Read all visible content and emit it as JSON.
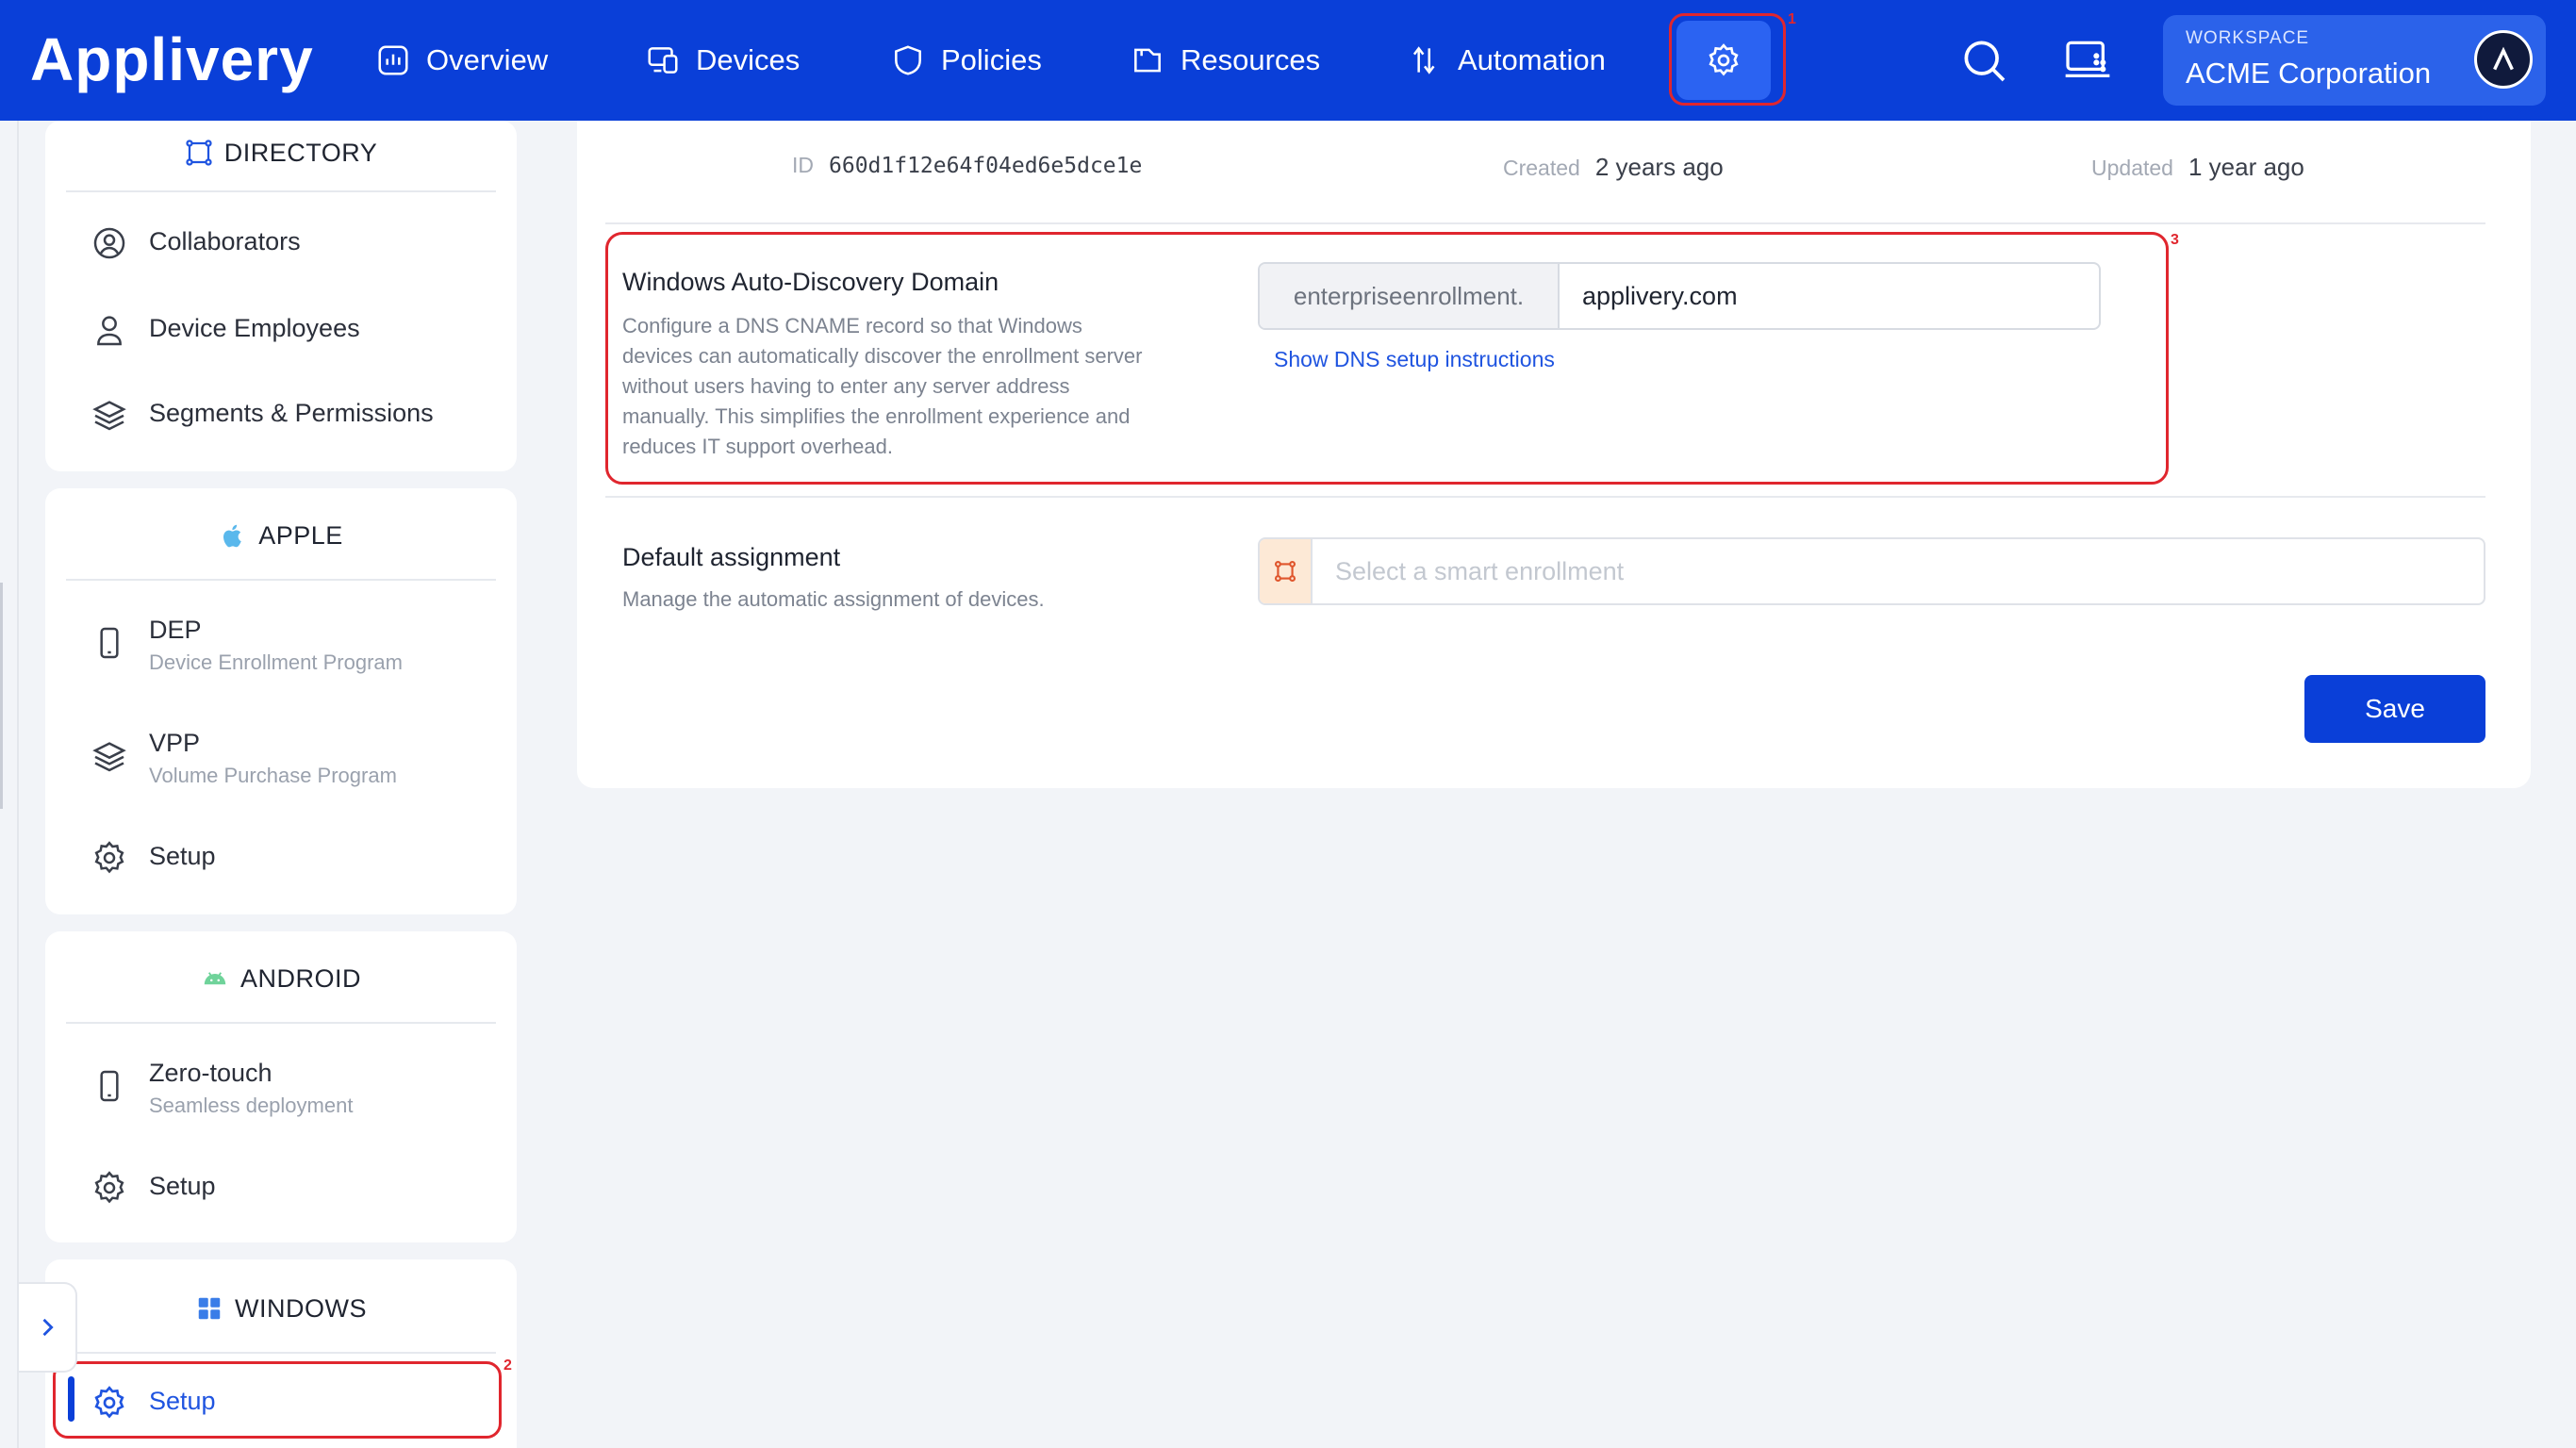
{
  "app": {
    "logo": "Applivery"
  },
  "nav": {
    "items": [
      {
        "label": "Overview",
        "icon": "chart-box-icon"
      },
      {
        "label": "Devices",
        "icon": "devices-icon"
      },
      {
        "label": "Policies",
        "icon": "shield-icon"
      },
      {
        "label": "Resources",
        "icon": "folder-icon"
      },
      {
        "label": "Automation",
        "icon": "arrows-icon"
      }
    ],
    "settings_badge": "1"
  },
  "workspace": {
    "label": "WORKSPACE",
    "name": "ACME Corporation"
  },
  "sidebar": {
    "directory": {
      "title": "DIRECTORY",
      "items": [
        {
          "label": "Collaborators"
        },
        {
          "label": "Device Employees"
        },
        {
          "label": "Segments & Permissions"
        }
      ]
    },
    "apple": {
      "title": "APPLE",
      "items": [
        {
          "label": "DEP",
          "sub": "Device Enrollment Program"
        },
        {
          "label": "VPP",
          "sub": "Volume Purchase Program"
        },
        {
          "label": "Setup"
        }
      ]
    },
    "android": {
      "title": "ANDROID",
      "items": [
        {
          "label": "Zero-touch",
          "sub": "Seamless deployment"
        },
        {
          "label": "Setup"
        }
      ]
    },
    "windows": {
      "title": "WINDOWS",
      "items": [
        {
          "label": "Setup"
        }
      ],
      "badge": "2"
    }
  },
  "meta": {
    "id_label": "ID",
    "id_value": "660d1f12e64f04ed6e5dce1e",
    "created_label": "Created",
    "created_value": "2 years ago",
    "updated_label": "Updated",
    "updated_value": "1 year ago"
  },
  "autodiscovery": {
    "badge": "3",
    "title": "Windows Auto-Discovery Domain",
    "description": "Configure a DNS CNAME record so that Windows devices can automatically discover the enrollment server without users having to enter any server address manually. This simplifies the enrollment experience and reduces IT support overhead.",
    "prefix": "enterpriseenrollment.",
    "domain": "applivery.com",
    "link": "Show DNS setup instructions"
  },
  "assignment": {
    "title": "Default assignment",
    "description": "Manage the automatic assignment of devices.",
    "placeholder": "Select a smart enrollment"
  },
  "actions": {
    "save": "Save"
  },
  "colors": {
    "primary": "#0a3fd8",
    "highlight": "#e0262e",
    "link": "#1f54e0"
  }
}
